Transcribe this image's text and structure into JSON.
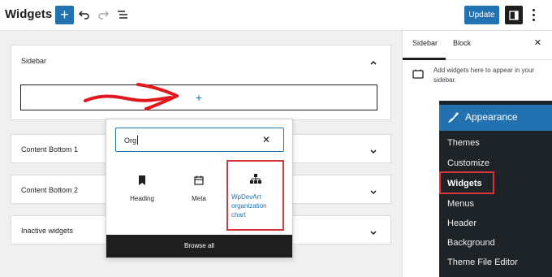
{
  "app": {
    "title": "Widgets",
    "update_label": "Update"
  },
  "areas": [
    {
      "title": "Sidebar"
    },
    {
      "title": "Content Bottom 1"
    },
    {
      "title": "Content Bottom 2"
    },
    {
      "title": "Inactive widgets"
    }
  ],
  "inserter": {
    "search_value": "Org",
    "blocks": [
      {
        "label": "Heading",
        "icon": "bookmark-icon"
      },
      {
        "label": "Meta",
        "icon": "calendar-icon"
      },
      {
        "label": "WpDevArt organization chart",
        "icon": "org-chart-icon"
      }
    ],
    "browse_all_label": "Browse all"
  },
  "sidebar": {
    "tabs": [
      "Sidebar",
      "Block"
    ],
    "description": "Add widgets here to appear in your sidebar."
  },
  "admin_menu": {
    "heading": "Appearance",
    "items": [
      "Themes",
      "Customize",
      "Widgets",
      "Menus",
      "Header",
      "Background",
      "Theme File Editor"
    ],
    "current": "Widgets"
  },
  "colors": {
    "accent": "#2271b1",
    "highlight": "#d63638",
    "admin_bg": "#1d2327"
  }
}
